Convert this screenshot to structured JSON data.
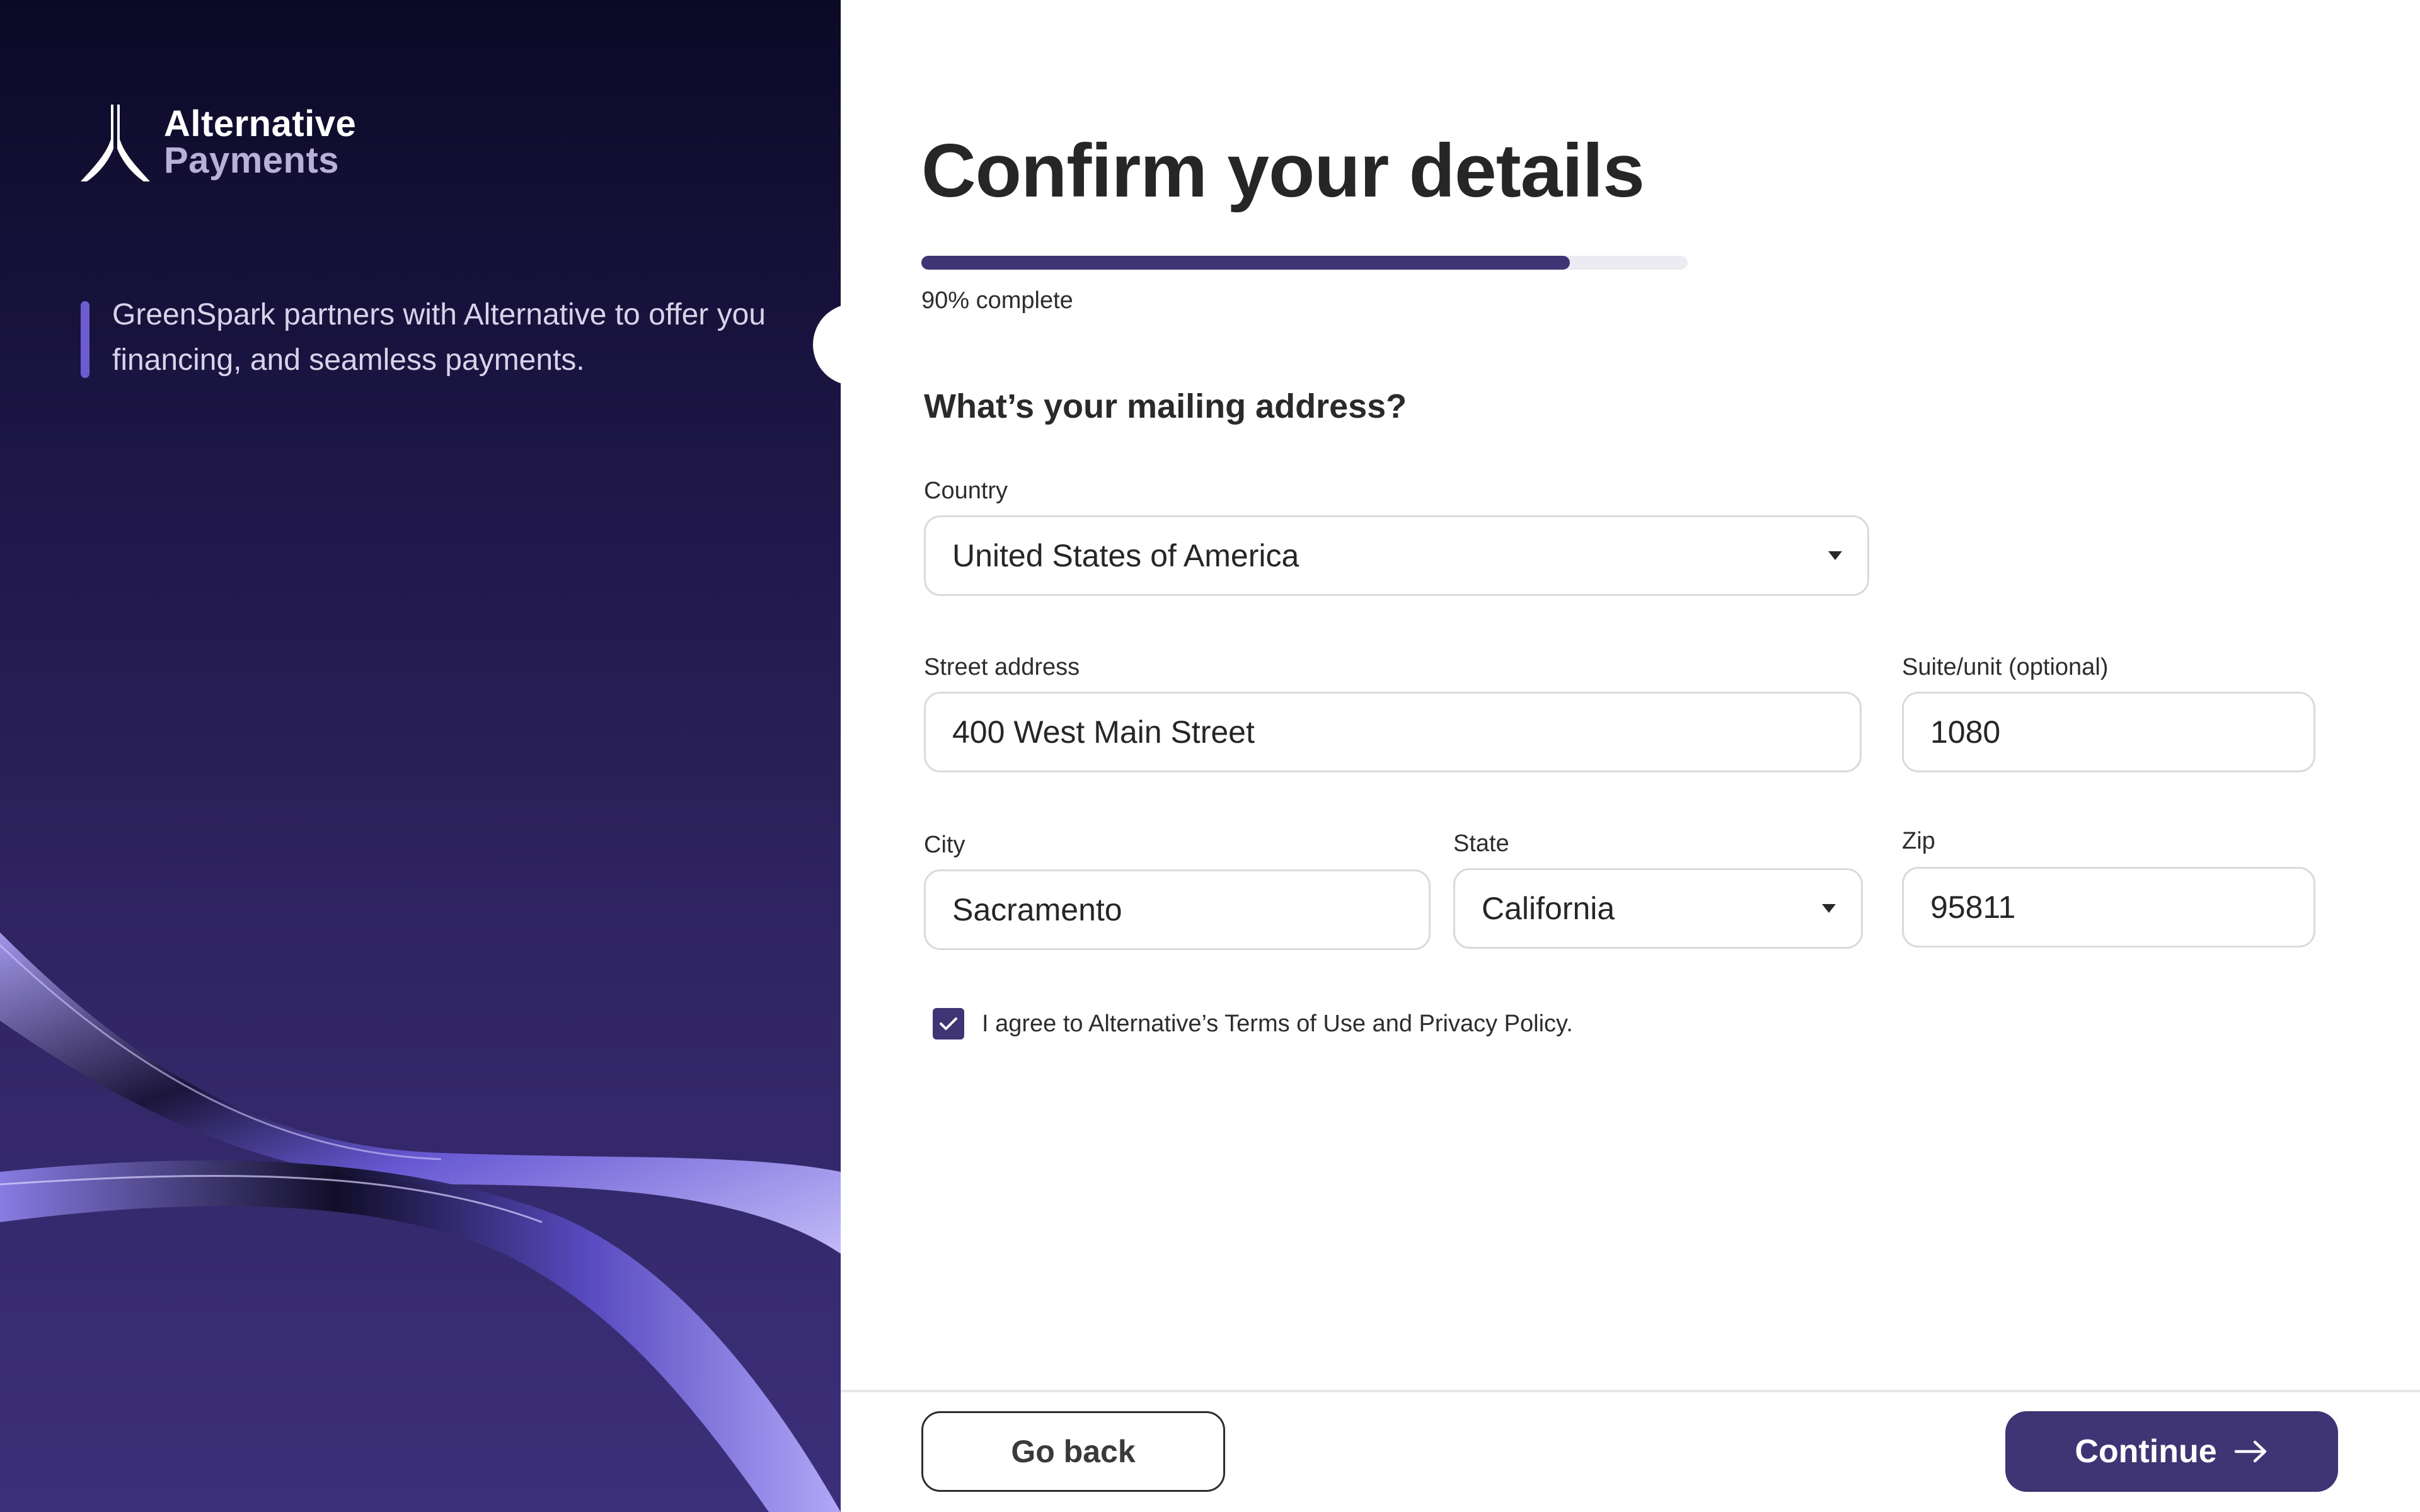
{
  "brand": {
    "name_line1": "Alternative",
    "name_line2": "Payments",
    "tagline": "GreenSpark partners with Alternative to offer you financing, and seamless payments.",
    "accent_color": "#3f3474",
    "panel_color": "#2f2461"
  },
  "page": {
    "title": "Confirm your details",
    "progress_percent": 90,
    "progress_label": "90% complete"
  },
  "form": {
    "section_title": "What’s your mailing address?",
    "country": {
      "label": "Country",
      "value": "United States of America"
    },
    "street": {
      "label": "Street address",
      "value": "400 West Main Street"
    },
    "suite": {
      "label": "Suite/unit (optional)",
      "value": "1080"
    },
    "city": {
      "label": "City",
      "value": "Sacramento"
    },
    "state": {
      "label": "State",
      "value": "California"
    },
    "zip": {
      "label": "Zip",
      "value": "95811"
    },
    "agree": {
      "checked": true,
      "label": "I agree to Alternative’s Terms of Use and Privacy Policy."
    }
  },
  "footer": {
    "back_label": "Go back",
    "continue_label": "Continue"
  },
  "icons": {
    "logo": "alternative-logo-icon",
    "dropdown": "chevron-down-icon",
    "check": "check-icon",
    "continue": "arrow-right-icon"
  }
}
